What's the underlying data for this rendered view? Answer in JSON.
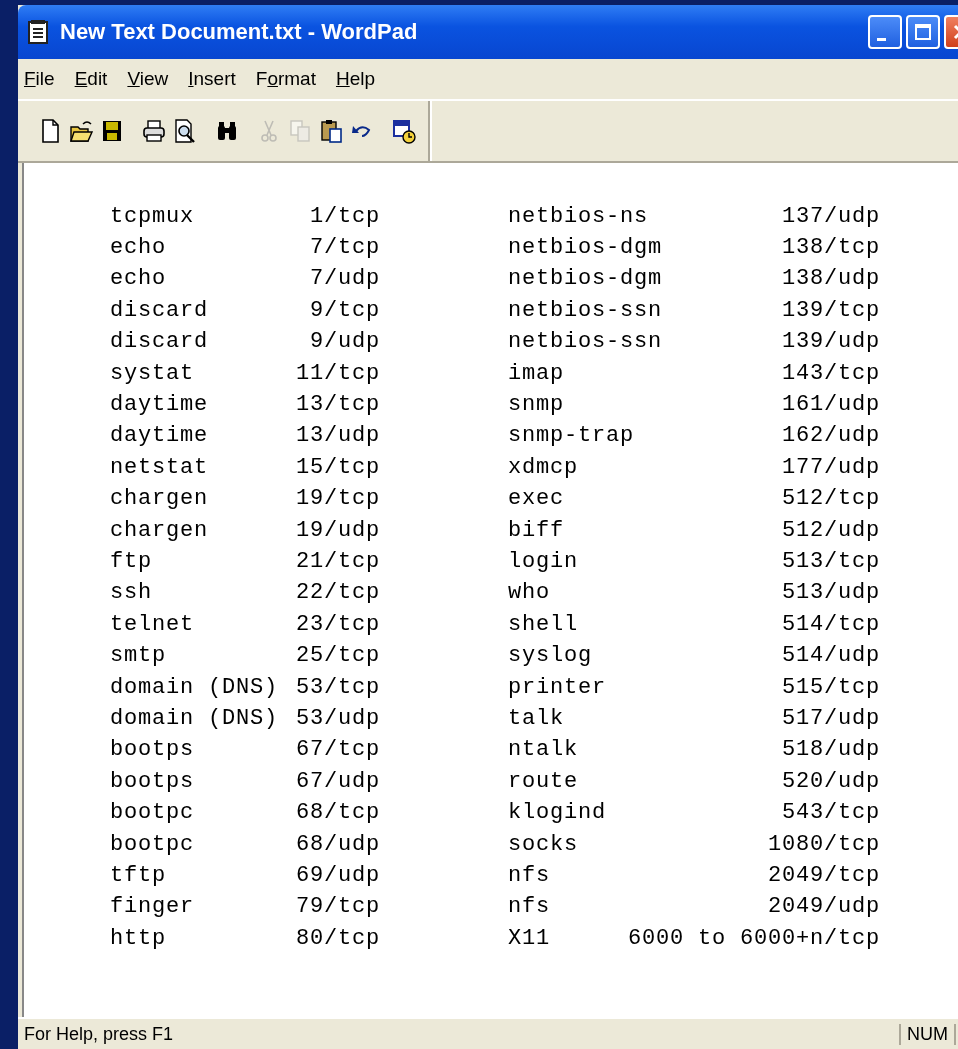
{
  "window": {
    "title": "New Text Document.txt - WordPad",
    "buttons": [
      {
        "kind": "minimize"
      },
      {
        "kind": "maximize"
      },
      {
        "kind": "close"
      }
    ]
  },
  "menu": [
    {
      "key": "F",
      "post": "ile"
    },
    {
      "key": "E",
      "post": "dit"
    },
    {
      "key": "V",
      "post": "iew"
    },
    {
      "key": "I",
      "post": "nsert"
    },
    {
      "pre": "F",
      "key": "o",
      "post": "rmat"
    },
    {
      "key": "H",
      "post": "elp"
    }
  ],
  "toolbar": {
    "groups": [
      [
        {
          "kind": "new",
          "disabled": false
        },
        {
          "kind": "open",
          "disabled": false
        },
        {
          "kind": "save",
          "disabled": false
        }
      ],
      [
        {
          "kind": "print",
          "disabled": false
        },
        {
          "kind": "preview",
          "disabled": false
        }
      ],
      [
        {
          "kind": "find",
          "disabled": false
        }
      ],
      [
        {
          "kind": "cut",
          "disabled": true
        },
        {
          "kind": "copy",
          "disabled": true
        },
        {
          "kind": "paste",
          "disabled": false
        },
        {
          "kind": "undo",
          "disabled": false
        }
      ],
      [
        {
          "kind": "datetime",
          "disabled": false
        }
      ]
    ]
  },
  "document": {
    "rows": [
      [
        "tcpmux",
        "1/tcp",
        "netbios-ns",
        "137/udp"
      ],
      [
        "echo",
        "7/tcp",
        "netbios-dgm",
        "138/tcp"
      ],
      [
        "echo",
        "7/udp",
        "netbios-dgm",
        "138/udp"
      ],
      [
        "discard",
        "9/tcp",
        "netbios-ssn",
        "139/tcp"
      ],
      [
        "discard",
        "9/udp",
        "netbios-ssn",
        "139/udp"
      ],
      [
        "systat",
        "11/tcp",
        "imap",
        "143/tcp"
      ],
      [
        "daytime",
        "13/tcp",
        "snmp",
        "161/udp"
      ],
      [
        "daytime",
        "13/udp",
        "snmp-trap",
        "162/udp"
      ],
      [
        "netstat",
        "15/tcp",
        "xdmcp",
        "177/udp"
      ],
      [
        "chargen",
        "19/tcp",
        "exec",
        "512/tcp"
      ],
      [
        "chargen",
        "19/udp",
        "biff",
        "512/udp"
      ],
      [
        "ftp",
        "21/tcp",
        "login",
        "513/tcp"
      ],
      [
        "ssh",
        "22/tcp",
        "who",
        "513/udp"
      ],
      [
        "telnet",
        "23/tcp",
        "shell",
        "514/tcp"
      ],
      [
        "smtp",
        "25/tcp",
        "syslog",
        "514/udp"
      ],
      [
        "domain (DNS)",
        "53/tcp",
        "printer",
        "515/tcp"
      ],
      [
        "domain (DNS)",
        "53/udp",
        "talk",
        "517/udp"
      ],
      [
        "bootps",
        "67/tcp",
        "ntalk",
        "518/udp"
      ],
      [
        "bootps",
        "67/udp",
        "route",
        "520/udp"
      ],
      [
        "bootpc",
        "68/tcp",
        "klogind",
        "543/tcp"
      ],
      [
        "bootpc",
        "68/udp",
        "socks",
        "1080/tcp"
      ],
      [
        "tftp",
        "69/udp",
        "nfs",
        "2049/tcp"
      ],
      [
        "finger",
        "79/tcp",
        "nfs",
        "2049/udp"
      ],
      [
        "http",
        "80/tcp",
        "X11",
        "6000 to 6000+n/tcp"
      ]
    ]
  },
  "status_bar": {
    "message": "For Help, press F1",
    "indicator": "NUM"
  }
}
